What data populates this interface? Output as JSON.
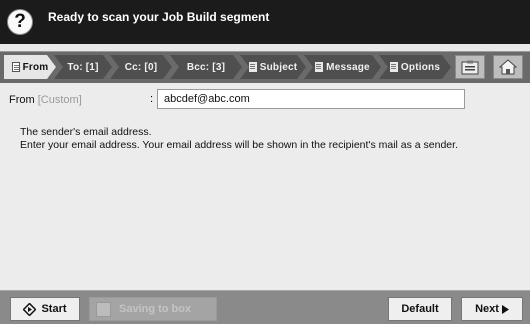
{
  "header": {
    "title": "Ready to scan your Job Build segment",
    "help_icon": "?"
  },
  "tabs": [
    {
      "label": "From",
      "active": true
    },
    {
      "label": "To: [1]"
    },
    {
      "label": "Cc: [0]"
    },
    {
      "label": "Bcc: [3]"
    },
    {
      "label": "Subject"
    },
    {
      "label": "Message"
    },
    {
      "label": "Options"
    }
  ],
  "toolbar_icons": [
    "address-book-icon",
    "home-icon"
  ],
  "form": {
    "from_label": "From",
    "from_qualifier": "[Custom]",
    "colon": ":",
    "from_value": "abcdef@abc.com"
  },
  "description": {
    "line1": "The sender's email address.",
    "line2": "Enter your email address. Your email address will be shown in the recipient's mail as a sender."
  },
  "footer": {
    "start_label": "Start",
    "saving_label": "Saving to box",
    "default_label": "Default",
    "next_label": "Next"
  }
}
